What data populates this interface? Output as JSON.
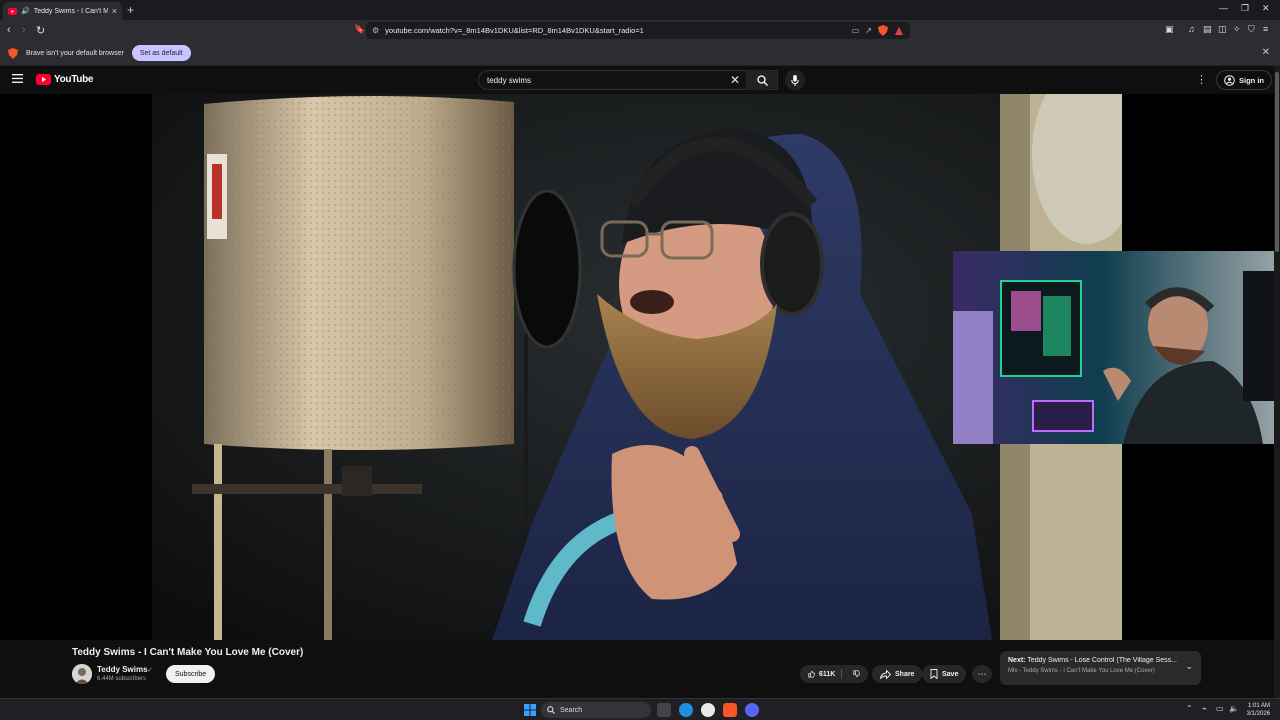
{
  "browser": {
    "tab_title": "Teddy Swims - I Can't Make Y",
    "url": "youtube.com/watch?v=_8m14Bv1DKU&list=RD_8m14Bv1DKU&start_radio=1",
    "infobar_message": "Brave isn't your default browser",
    "set_default_label": "Set as default"
  },
  "youtube": {
    "logo_text": "YouTube",
    "search_value": "teddy swims",
    "signin_label": "Sign in"
  },
  "video": {
    "title": "Teddy Swims - I Can't Make You Love Me (Cover)",
    "channel": "Teddy Swims",
    "subscribers": "6.44M subscribers",
    "subscribe_label": "Subscribe",
    "likes": "611K",
    "share_label": "Share",
    "save_label": "Save"
  },
  "next_up": {
    "prefix": "Next:",
    "title": "Teddy Swims - Lose Control (The Village Sess...",
    "subtitle": "Mix - Teddy Swims - I Can't Make You Love Me (Cover)"
  },
  "taskbar": {
    "search_label": "Search",
    "time": "1:01 AM",
    "date": "3/1/2026"
  },
  "colors": {
    "youtube_red": "#ff0033",
    "brave_orange": "#fb542b",
    "set_default_bg": "#c9c3ff"
  }
}
